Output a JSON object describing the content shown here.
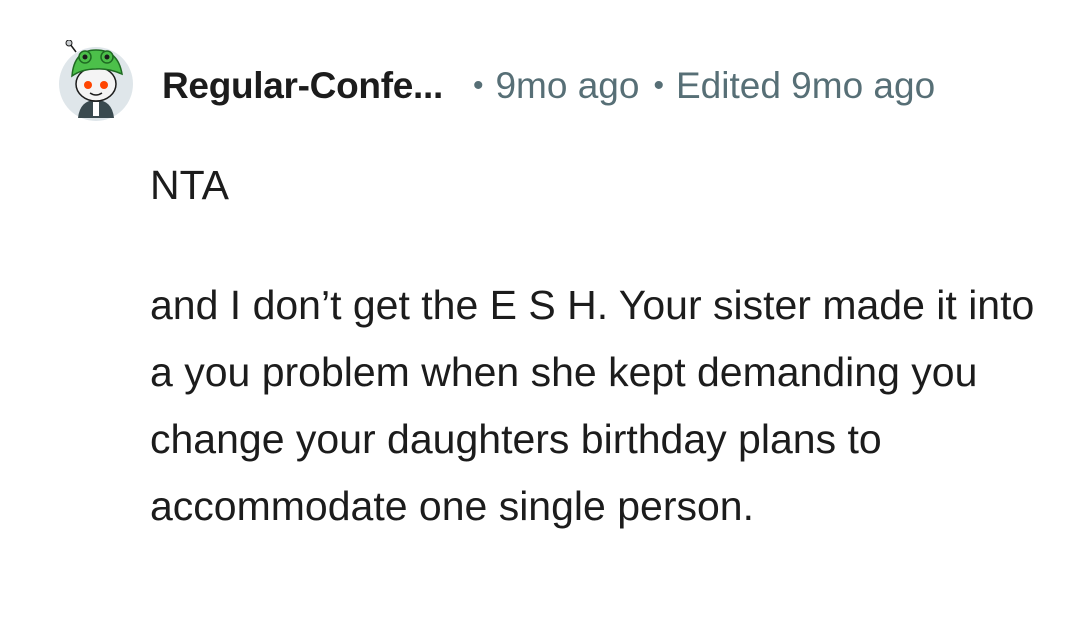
{
  "comment": {
    "username": "Regular-Confe...",
    "age": "9mo ago",
    "edited": "Edited 9mo ago",
    "separator": "•",
    "paragraphs": [
      "NTA",
      "and I don’t get the E S H. Your sister made it into a you problem when she kept demanding you change your daughters birthday plans to accommodate one single person."
    ],
    "avatar_icon": "snoo-avatar-icon"
  }
}
